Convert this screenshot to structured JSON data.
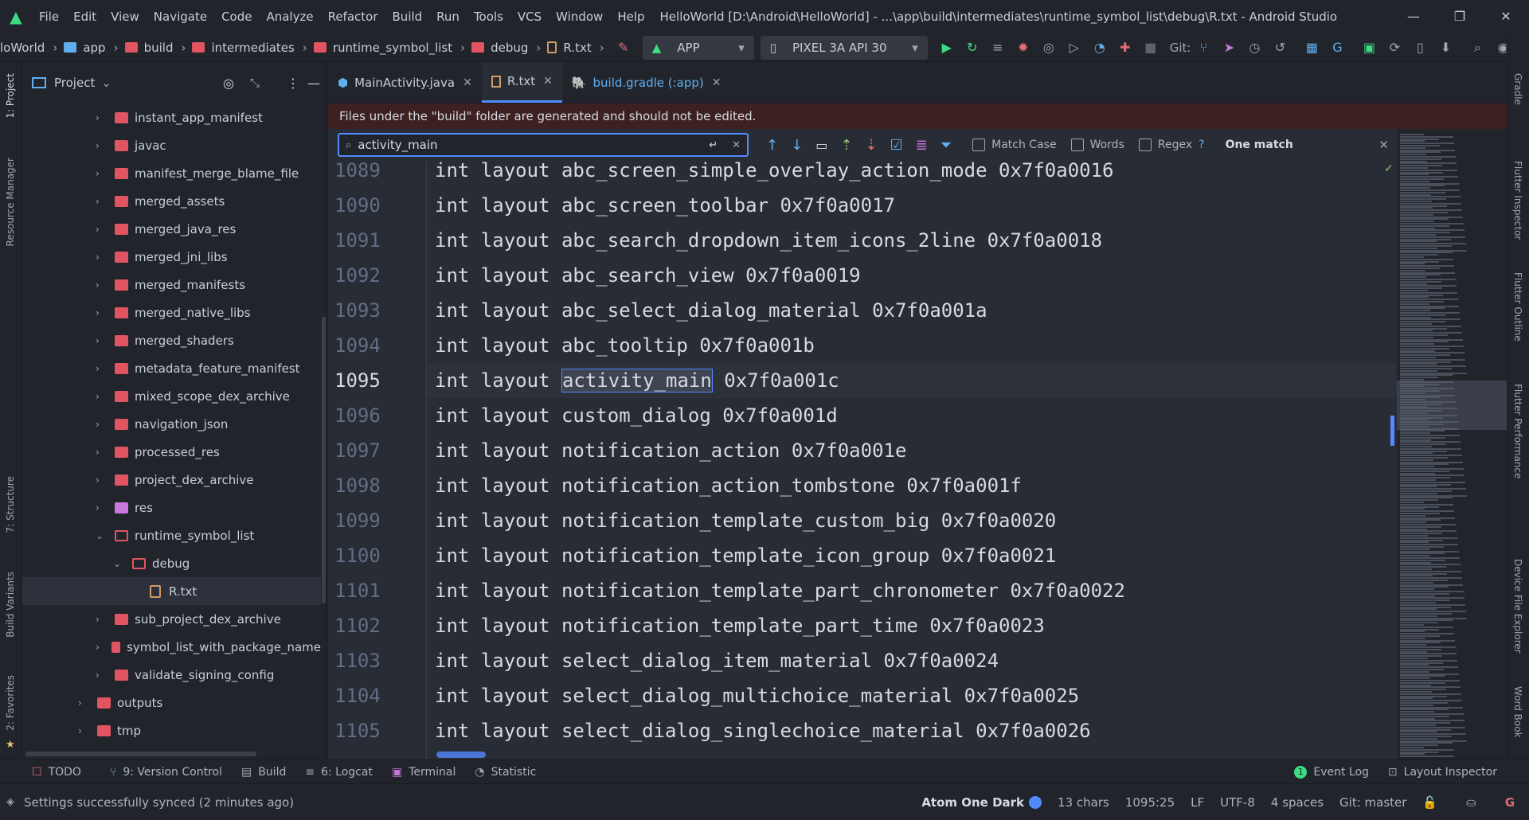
{
  "app": {
    "window_title": "HelloWorld [D:\\Android\\HelloWorld] - ...\\app\\build\\intermediates\\runtime_symbol_list\\debug\\R.txt - Android Studio",
    "accent": "#528bff",
    "error_color": "#e05561"
  },
  "menu": [
    "File",
    "Edit",
    "View",
    "Navigate",
    "Code",
    "Analyze",
    "Refactor",
    "Build",
    "Run",
    "Tools",
    "VCS",
    "Window",
    "Help"
  ],
  "breadcrumbs": [
    "loWorld",
    "app",
    "build",
    "intermediates",
    "runtime_symbol_list",
    "debug",
    "R.txt"
  ],
  "run_config": {
    "module": "APP",
    "device": "PIXEL 3A API 30",
    "git_label": "Git:"
  },
  "left_strip": {
    "project": "1: Project",
    "resource_manager": "Resource Manager",
    "structure": "7: Structure",
    "build_variants": "Build Variants",
    "favorites": "2: Favorites"
  },
  "project_panel": {
    "title": "Project",
    "items": [
      {
        "label": "instant_app_manifest"
      },
      {
        "label": "javac"
      },
      {
        "label": "manifest_merge_blame_file"
      },
      {
        "label": "merged_assets"
      },
      {
        "label": "merged_java_res"
      },
      {
        "label": "merged_jni_libs"
      },
      {
        "label": "merged_manifests"
      },
      {
        "label": "merged_native_libs"
      },
      {
        "label": "merged_shaders"
      },
      {
        "label": "metadata_feature_manifest"
      },
      {
        "label": "mixed_scope_dex_archive"
      },
      {
        "label": "navigation_json"
      },
      {
        "label": "processed_res"
      },
      {
        "label": "project_dex_archive"
      },
      {
        "label": "res"
      },
      {
        "label": "runtime_symbol_list"
      },
      {
        "label": "debug"
      },
      {
        "label": "R.txt"
      },
      {
        "label": "sub_project_dex_archive"
      },
      {
        "label": "symbol_list_with_package_name"
      },
      {
        "label": "validate_signing_config"
      },
      {
        "label": "outputs"
      },
      {
        "label": "tmp"
      }
    ]
  },
  "tabs": [
    {
      "label": "MainActivity.java"
    },
    {
      "label": "R.txt"
    },
    {
      "label": "build.gradle (:app)"
    }
  ],
  "notice": "Files under the \"build\" folder are generated and should not be edited.",
  "search": {
    "value": "activity_main",
    "match_case": "Match Case",
    "words": "Words",
    "regex": "Regex",
    "help": "?",
    "result": "One match"
  },
  "editor": {
    "lines": [
      {
        "n": "1089",
        "code": "int layout abc_screen_simple_overlay_action_mode 0x7f0a0016"
      },
      {
        "n": "1090",
        "code": "int layout abc_screen_toolbar 0x7f0a0017"
      },
      {
        "n": "1091",
        "code": "int layout abc_search_dropdown_item_icons_2line 0x7f0a0018"
      },
      {
        "n": "1092",
        "code": "int layout abc_search_view 0x7f0a0019"
      },
      {
        "n": "1093",
        "code": "int layout abc_select_dialog_material 0x7f0a001a"
      },
      {
        "n": "1094",
        "code": "int layout abc_tooltip 0x7f0a001b"
      },
      {
        "n": "1095",
        "pre": "int layout ",
        "match": "activity_main",
        "post": " 0x7f0a001c"
      },
      {
        "n": "1096",
        "code": "int layout custom_dialog 0x7f0a001d"
      },
      {
        "n": "1097",
        "code": "int layout notification_action 0x7f0a001e"
      },
      {
        "n": "1098",
        "code": "int layout notification_action_tombstone 0x7f0a001f"
      },
      {
        "n": "1099",
        "code": "int layout notification_template_custom_big 0x7f0a0020"
      },
      {
        "n": "1100",
        "code": "int layout notification_template_icon_group 0x7f0a0021"
      },
      {
        "n": "1101",
        "code": "int layout notification_template_part_chronometer 0x7f0a0022"
      },
      {
        "n": "1102",
        "code": "int layout notification_template_part_time 0x7f0a0023"
      },
      {
        "n": "1103",
        "code": "int layout select_dialog_item_material 0x7f0a0024"
      },
      {
        "n": "1104",
        "code": "int layout select_dialog_multichoice_material 0x7f0a0025"
      },
      {
        "n": "1105",
        "code": "int layout select_dialog_singlechoice_material 0x7f0a0026"
      }
    ]
  },
  "right_strip": {
    "gradle": "Gradle",
    "flutter_inspector": "Flutter Inspector",
    "flutter_outline": "Flutter Outline",
    "flutter_performance": "Flutter Performance",
    "device_file_explorer": "Device File Explorer",
    "word_book": "Word Book"
  },
  "tool_windows": {
    "todo": "TODO",
    "version_control": "9: Version Control",
    "build": "Build",
    "logcat": "6: Logcat",
    "terminal": "Terminal",
    "statistic": "Statistic",
    "event_log": "Event Log",
    "event_log_count": "1",
    "layout_inspector": "Layout Inspector"
  },
  "status": {
    "message": "Settings successfully synced (2 minutes ago)",
    "theme": "Atom One Dark",
    "chars": "13 chars",
    "position": "1095:25",
    "line_sep": "LF",
    "encoding": "UTF-8",
    "indent": "4 spaces",
    "git": "Git: master"
  }
}
